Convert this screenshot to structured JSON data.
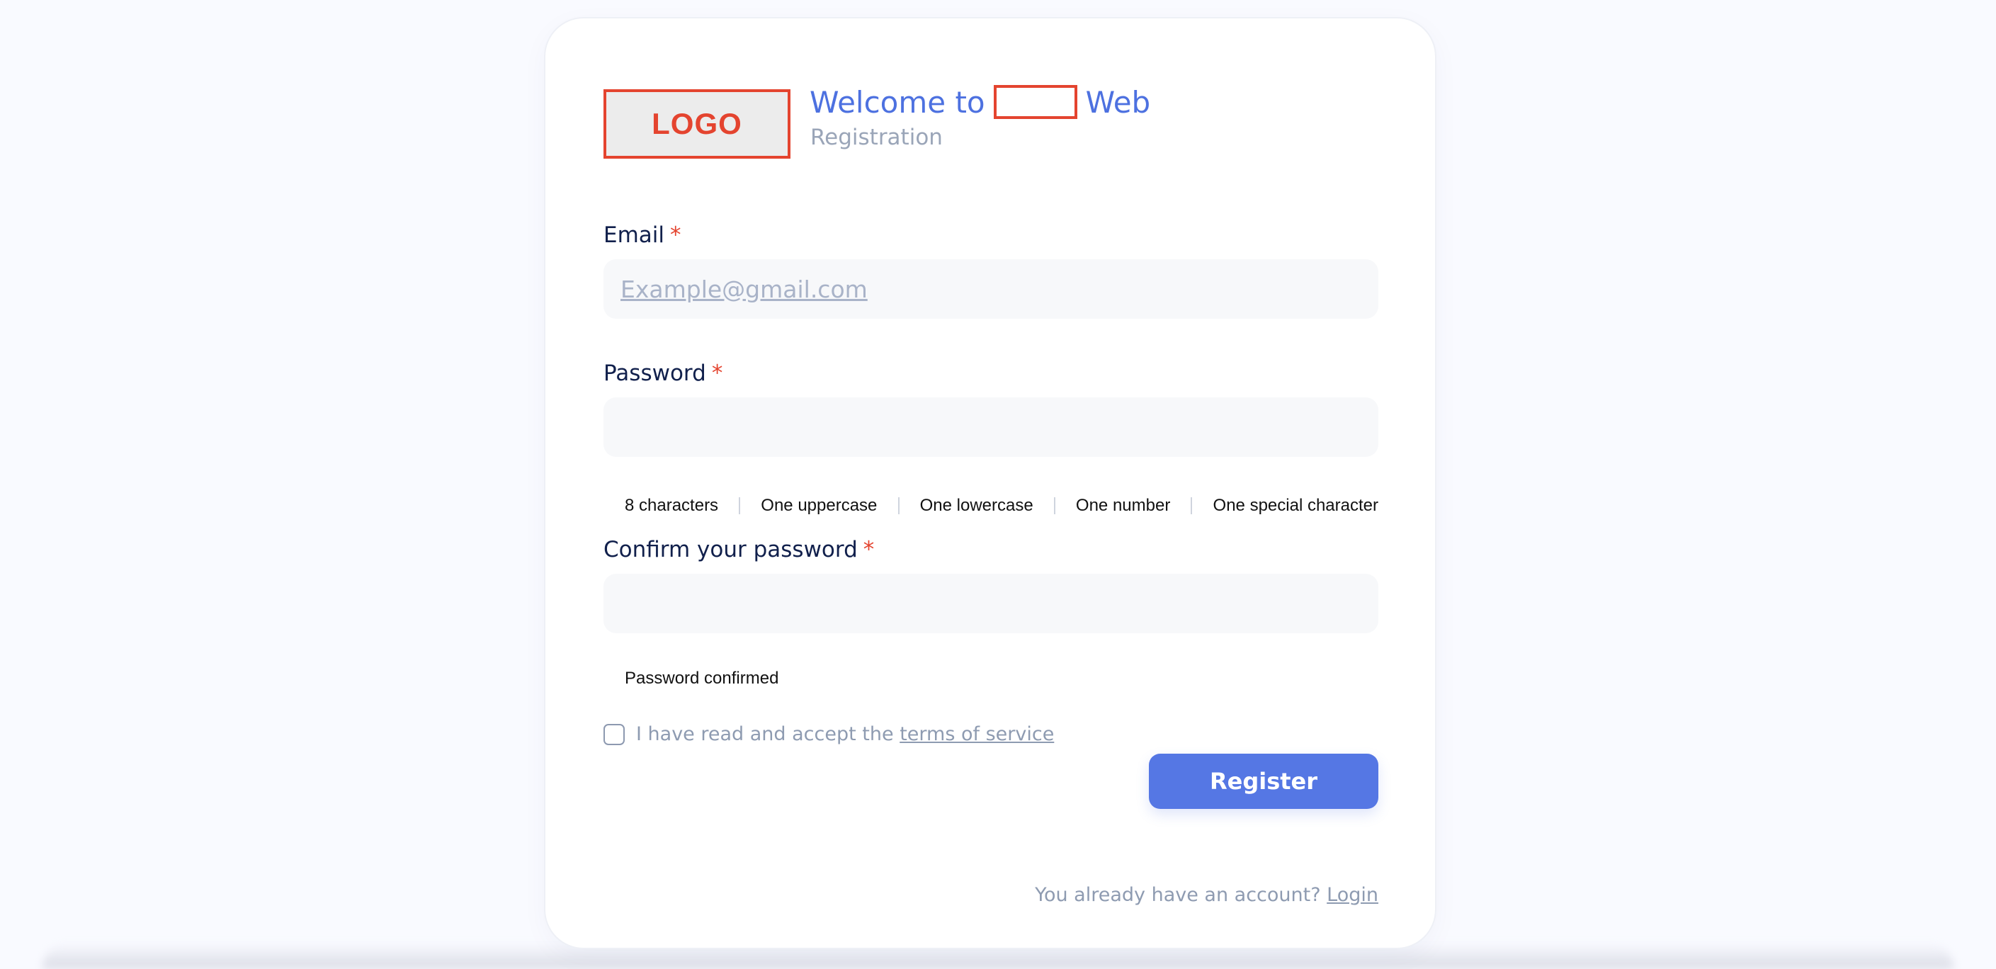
{
  "header": {
    "logo_text": "LOGO",
    "welcome_prefix": "Welcome to",
    "welcome_suffix": "Web",
    "subtitle": "Registration"
  },
  "email": {
    "label": "Email",
    "required_mark": "*",
    "placeholder": "Example@gmail.com",
    "value": ""
  },
  "password": {
    "label": "Password",
    "required_mark": "*",
    "value": "",
    "requirements": [
      "8 characters",
      "One uppercase",
      "One lowercase",
      "One number",
      "One special character"
    ]
  },
  "confirm_password": {
    "label": "Confirm your password",
    "required_mark": "*",
    "value": "",
    "status": "Password confirmed"
  },
  "terms": {
    "checked": false,
    "text": "I have read and accept the",
    "link_text": "terms of service"
  },
  "register_button": {
    "label": "Register"
  },
  "footer": {
    "prompt": "You already have an account?",
    "login_link": "Login"
  },
  "colors": {
    "accent": "#5577e4",
    "required": "#e4442f",
    "label": "#11204c",
    "muted": "#8e9bb1",
    "input_background": "#f7f8fa",
    "page_background": "#f9faff"
  }
}
